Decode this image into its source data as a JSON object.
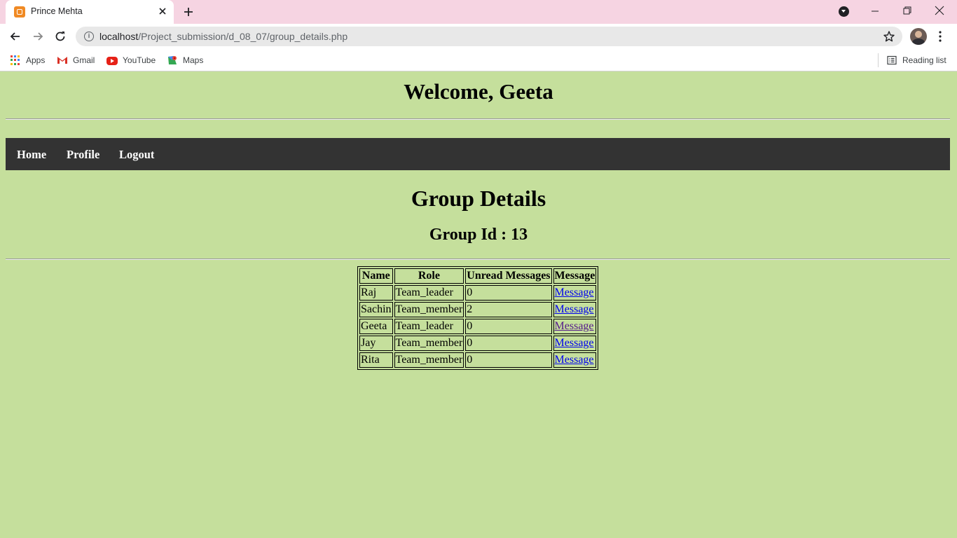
{
  "browser": {
    "tab_title": "Prince Mehta",
    "url_host": "localhost",
    "url_path": "/Project_submission/d_08_07/group_details.php",
    "bookmarks": [
      {
        "label": "Apps",
        "icon": "apps-grid-icon"
      },
      {
        "label": "Gmail",
        "icon": "gmail-icon"
      },
      {
        "label": "YouTube",
        "icon": "youtube-icon"
      },
      {
        "label": "Maps",
        "icon": "maps-icon"
      }
    ],
    "reading_list": "Reading list"
  },
  "page": {
    "welcome": "Welcome, Geeta",
    "nav": [
      {
        "label": "Home"
      },
      {
        "label": "Profile"
      },
      {
        "label": "Logout"
      }
    ],
    "title": "Group Details",
    "group_id": "Group Id : 13",
    "table": {
      "headers": [
        "Name",
        "Role",
        "Unread Messages",
        "Message"
      ],
      "rows": [
        {
          "name": "Raj",
          "role": "Team_leader",
          "unread": "0",
          "message": "Message"
        },
        {
          "name": "Sachin",
          "role": "Team_member",
          "unread": "2",
          "message": "Message"
        },
        {
          "name": "Geeta",
          "role": "Team_leader",
          "unread": "0",
          "message": "Message"
        },
        {
          "name": "Jay",
          "role": "Team_member",
          "unread": "0",
          "message": "Message"
        },
        {
          "name": "Rita",
          "role": "Team_member",
          "unread": "0",
          "message": "Message"
        }
      ]
    }
  },
  "colors": {
    "page_bg": "#c5df9c",
    "navbar_bg": "#333333",
    "tabstrip_bg": "#f6d4e2",
    "link": "#0000ee",
    "visited_link": "#551a8b"
  }
}
